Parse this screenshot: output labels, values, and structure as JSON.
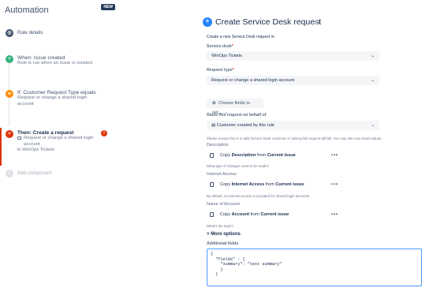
{
  "left": {
    "title": "Automation",
    "badge": "NEW",
    "rule_details": "Rule details",
    "trigger": {
      "head": "When: Issue created",
      "sub": "Rule is run when an issue is created."
    },
    "condition": {
      "head": "If: Customer Request Type equals",
      "sub": "Request or change a shared login account",
      "icon": "32"
    },
    "action": {
      "head": "Then: Create a request",
      "sub1": "Request or change a shared login account",
      "sub2": "in WinOps Tickets"
    },
    "add_component": "Add component"
  },
  "right": {
    "title": "Create Service Desk request",
    "intro": "Create a new Service Desk request in:",
    "service_desk_label": "Service desk",
    "service_desk_value": "WinOps Tickets",
    "request_type_label": "Request type",
    "request_type_value": "Request or change a shared login account",
    "choose_fields": "Choose fields to set...",
    "raise_label": "Raise this request on behalf of",
    "raise_value": "Customer created by this rule",
    "raise_help": "Please ensure this is a valid Service Desk customer or raising this request will fail. You may also use smart-values",
    "fields": [
      {
        "name": "Description",
        "copy_prefix": "Copy",
        "field": "Description",
        "from": "from",
        "source": "Current issue",
        "help": "What type of changes need to be made?"
      },
      {
        "name": "Internet Access",
        "copy_prefix": "Copy",
        "field": "Internet Access",
        "from": "from",
        "source": "Current issue",
        "help": "By default, no internet access is provided for shared login accounts"
      },
      {
        "name": "Name of Account",
        "copy_prefix": "Copy",
        "field": "Account",
        "from": "from",
        "source": "Current issue",
        "help": "What's the login?"
      }
    ],
    "more_options": "More options",
    "additional_fields": "Additional fields",
    "code": "{\n  \"fields\" : {\n    \"summary\": \"test summary\"\n    }\n  }",
    "more_dots": "•••"
  },
  "colors": {
    "trigger": "#36b37e",
    "condition": "#ff8b00",
    "action": "#de350b",
    "rule": "#42526e",
    "accent": "#2684ff"
  }
}
